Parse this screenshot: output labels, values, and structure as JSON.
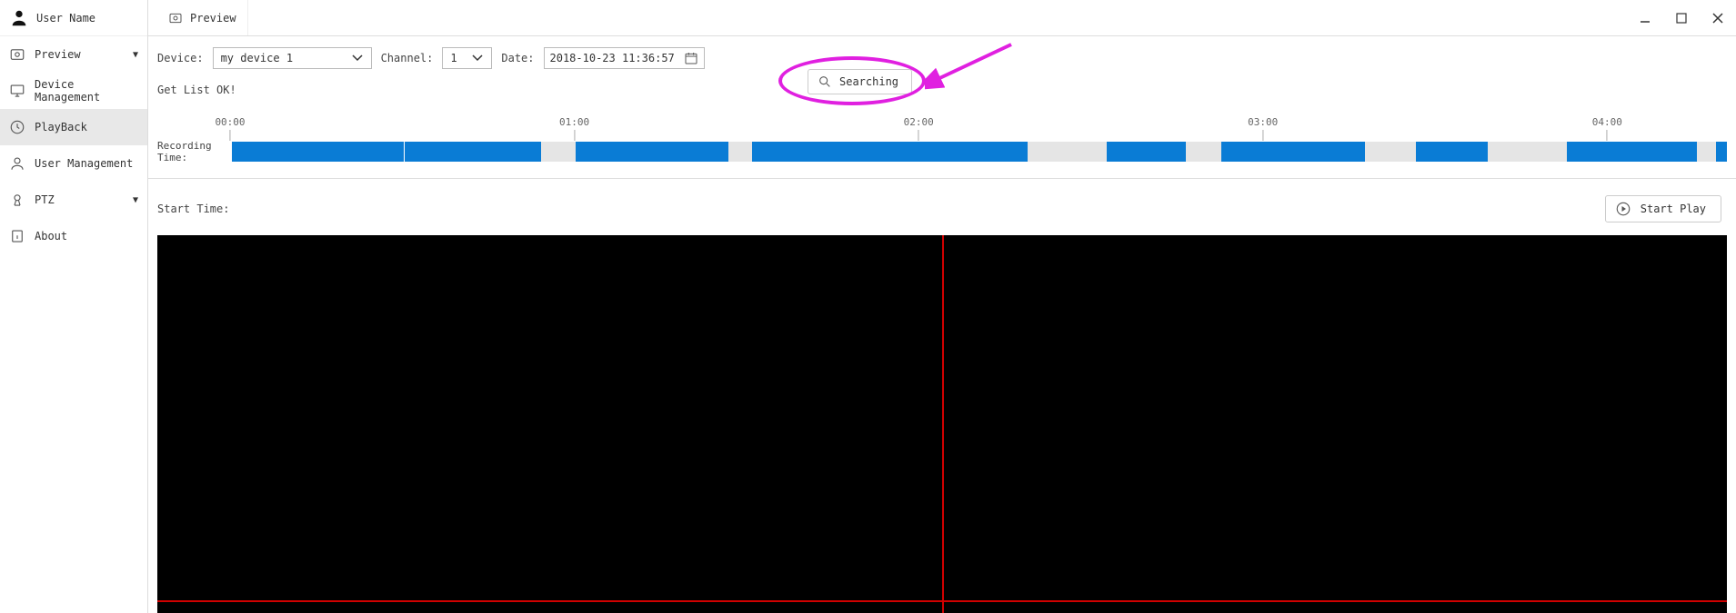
{
  "header": {
    "user_name": "User Name",
    "tab_title": "Preview"
  },
  "sidebar": {
    "items": [
      {
        "id": "preview",
        "label": "Preview",
        "has_caret": true
      },
      {
        "id": "device-management",
        "label": "Device Management",
        "has_caret": false
      },
      {
        "id": "playback",
        "label": "PlayBack",
        "has_caret": false,
        "active": true
      },
      {
        "id": "user-management",
        "label": "User Management",
        "has_caret": false
      },
      {
        "id": "ptz",
        "label": "PTZ",
        "has_caret": true
      },
      {
        "id": "about",
        "label": "About",
        "has_caret": false
      }
    ]
  },
  "filters": {
    "device_label": "Device:",
    "device_value": "my device 1",
    "channel_label": "Channel:",
    "channel_value": "1",
    "date_label": "Date:",
    "date_value": "2018-10-23 11:36:57"
  },
  "status": {
    "text": "Get List OK!",
    "search_button": "Searching"
  },
  "timeline": {
    "ticks": [
      "00:00",
      "01:00",
      "02:00",
      "03:00",
      "04:00"
    ],
    "recording_label": "Recording Time:",
    "segments_pct": [
      {
        "start": 0.0,
        "end": 20.7,
        "divider_at": 11.5
      },
      {
        "start": 23.0,
        "end": 33.2
      },
      {
        "start": 34.8,
        "end": 53.2
      },
      {
        "start": 58.5,
        "end": 63.8
      },
      {
        "start": 66.2,
        "end": 75.8
      },
      {
        "start": 79.2,
        "end": 84.0
      },
      {
        "start": 89.3,
        "end": 98.0
      },
      {
        "start": 99.3,
        "end": 100.0
      }
    ]
  },
  "start": {
    "label": "Start Time:",
    "play_button": "Start Play"
  },
  "annotation": {
    "kind": "ellipse-with-arrow",
    "target": "search-button",
    "color": "#e020e0"
  }
}
